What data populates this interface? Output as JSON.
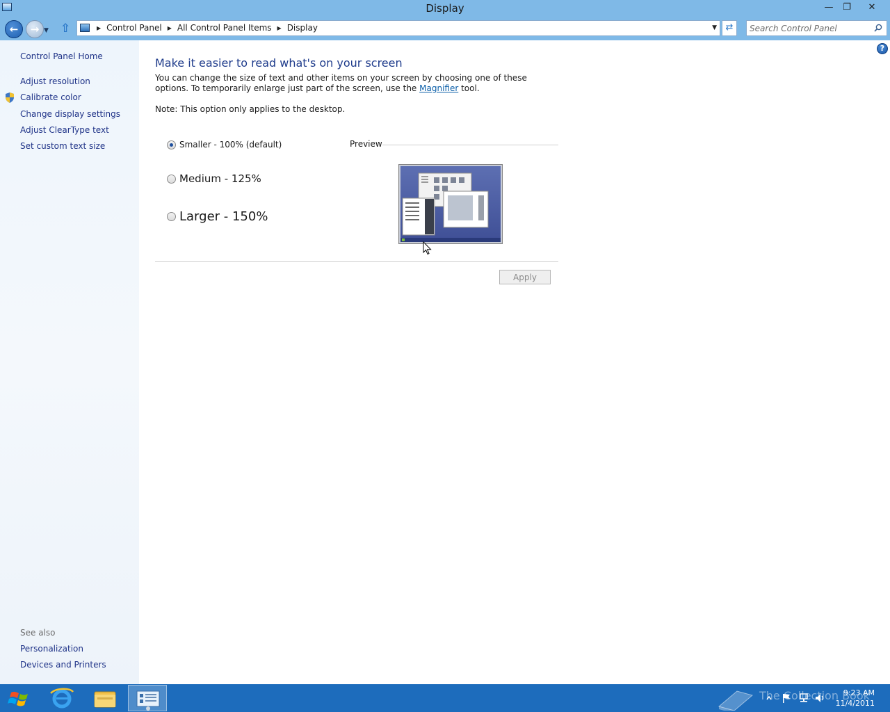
{
  "window": {
    "title": "Display"
  },
  "address": {
    "crumbs": [
      "Control Panel",
      "All Control Panel Items",
      "Display"
    ],
    "search_placeholder": "Search Control Panel"
  },
  "sidebar": {
    "home": "Control Panel Home",
    "items": [
      "Adjust resolution",
      "Calibrate color",
      "Change display settings",
      "Adjust ClearType text",
      "Set custom text size"
    ],
    "see_also_label": "See also",
    "see_also": [
      "Personalization",
      "Devices and Printers"
    ]
  },
  "main": {
    "heading": "Make it easier to read what's on your screen",
    "desc_before": "You can change the size of text and other items on your screen by choosing one of these options. To temporarily enlarge just part of the screen, use the ",
    "desc_link": "Magnifier",
    "desc_after": " tool.",
    "note": "Note: This option only applies to the desktop.",
    "options": [
      {
        "label": "Smaller - 100% (default)",
        "checked": true
      },
      {
        "label": "Medium - 125%",
        "checked": false
      },
      {
        "label": "Larger - 150%",
        "checked": false
      }
    ],
    "preview_label": "Preview",
    "apply_label": "Apply"
  },
  "taskbar": {
    "watermark": "The Collection Book",
    "time": "9:23 AM",
    "date": "11/4/2011"
  },
  "colors": {
    "titlebar": "#7fb9e7",
    "link": "#1e3287",
    "heading": "#1e3b8b",
    "taskbar": "#1d6cbc"
  }
}
